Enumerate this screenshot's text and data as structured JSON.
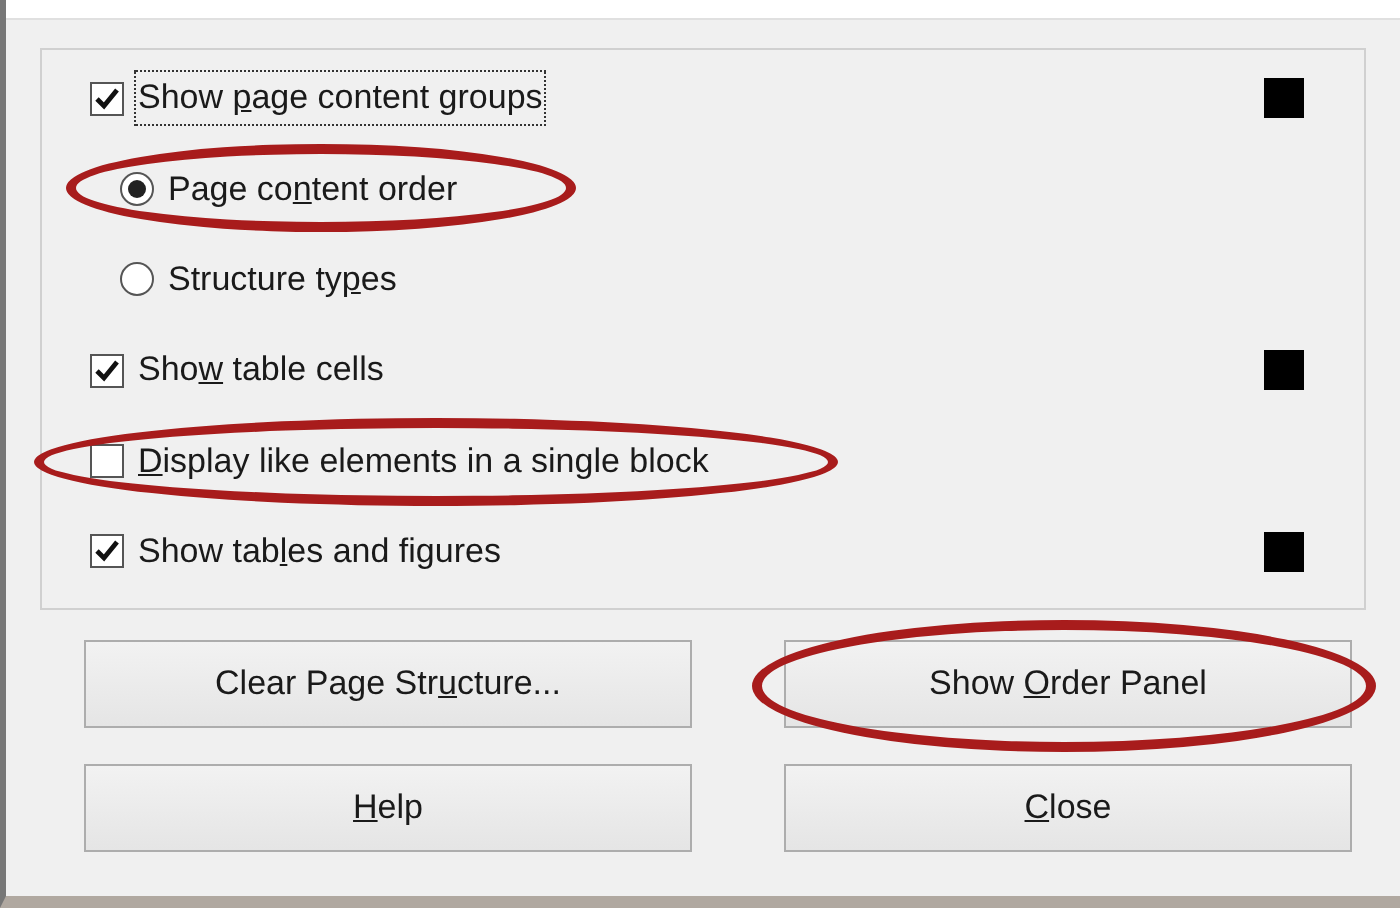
{
  "options": [
    {
      "kind": "checkbox",
      "label_before": "Show ",
      "mnemonic": "p",
      "label_after": "age content groups",
      "checked": true,
      "focused": true,
      "highlighted": false,
      "color": "#000000"
    },
    {
      "kind": "radio",
      "label_before": "Page co",
      "mnemonic": "n",
      "label_after": "tent order",
      "selected": true,
      "highlighted": true
    },
    {
      "kind": "radio",
      "label_before": "Structure ty",
      "mnemonic": "p",
      "label_after": "es",
      "selected": false,
      "highlighted": false
    },
    {
      "kind": "checkbox",
      "label_before": "Sho",
      "mnemonic": "w",
      "label_after": " table cells",
      "checked": true,
      "focused": false,
      "highlighted": false,
      "color": "#000000"
    },
    {
      "kind": "checkbox",
      "mnemonic": "D",
      "label_after": "isplay like elements in a single block",
      "checked": false,
      "focused": false,
      "highlighted": true
    },
    {
      "kind": "checkbox",
      "label_before": "Show tab",
      "mnemonic": "l",
      "label_after": "es and figures",
      "checked": true,
      "focused": false,
      "highlighted": false,
      "color": "#000000"
    }
  ],
  "buttons": [
    {
      "label_before": "Clear Page Str",
      "mnemonic": "u",
      "label_after": "cture...",
      "highlighted": false
    },
    {
      "label_before": "Show ",
      "mnemonic": "O",
      "label_after": "rder Panel",
      "highlighted": true
    },
    {
      "mnemonic": "H",
      "label_after": "elp",
      "highlighted": false
    },
    {
      "mnemonic": "C",
      "label_after": "lose",
      "highlighted": false
    }
  ]
}
